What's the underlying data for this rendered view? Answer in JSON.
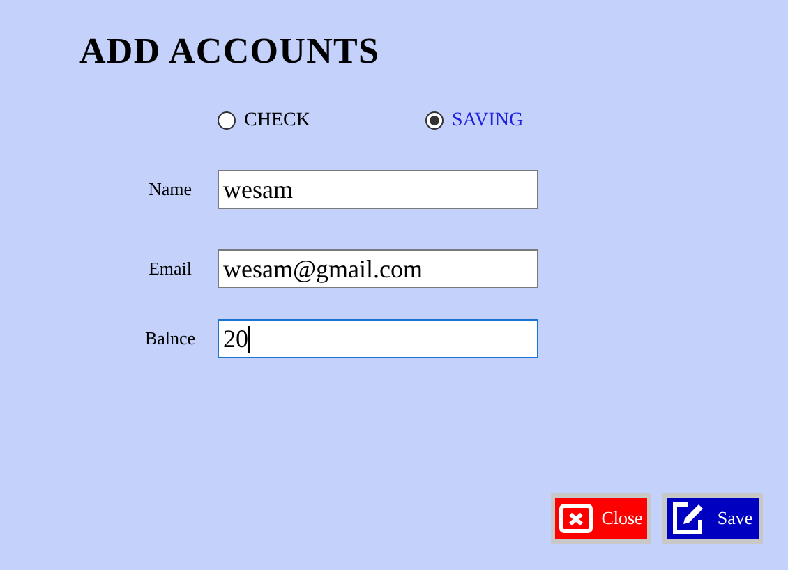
{
  "title": "ADD ACCOUNTS",
  "account_types": [
    {
      "label": "CHECK",
      "selected": false
    },
    {
      "label": "SAVING",
      "selected": true
    }
  ],
  "fields": [
    {
      "label": "Name",
      "value": "wesam",
      "focused": false
    },
    {
      "label": "Email",
      "value": "wesam@gmail.com",
      "focused": false
    },
    {
      "label": "Balnce",
      "value": "20",
      "focused": true
    }
  ],
  "buttons": [
    {
      "kind": "close",
      "label": "Close"
    },
    {
      "kind": "save",
      "label": "Save"
    }
  ]
}
